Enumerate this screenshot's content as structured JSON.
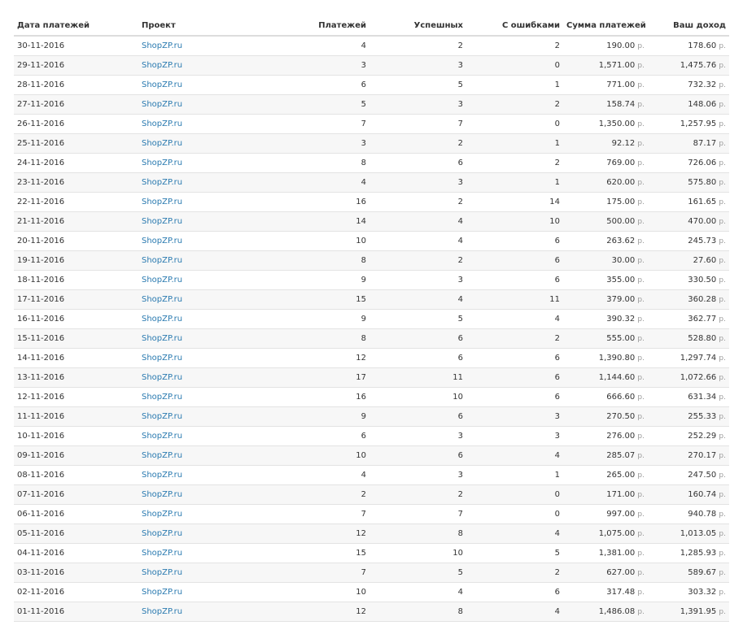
{
  "currency": "р.",
  "columns": {
    "date": "Дата платежей",
    "project": "Проект",
    "payments": "Платежей",
    "successful": "Успешных",
    "errors": "С ошибками",
    "sum": "Сумма платежей",
    "income": "Ваш доход"
  },
  "rows": [
    {
      "date": "30-11-2016",
      "project": "ShopZP.ru",
      "payments": "4",
      "successful": "2",
      "errors": "2",
      "sum": "190.00",
      "income": "178.60"
    },
    {
      "date": "29-11-2016",
      "project": "ShopZP.ru",
      "payments": "3",
      "successful": "3",
      "errors": "0",
      "sum": "1,571.00",
      "income": "1,475.76"
    },
    {
      "date": "28-11-2016",
      "project": "ShopZP.ru",
      "payments": "6",
      "successful": "5",
      "errors": "1",
      "sum": "771.00",
      "income": "732.32"
    },
    {
      "date": "27-11-2016",
      "project": "ShopZP.ru",
      "payments": "5",
      "successful": "3",
      "errors": "2",
      "sum": "158.74",
      "income": "148.06"
    },
    {
      "date": "26-11-2016",
      "project": "ShopZP.ru",
      "payments": "7",
      "successful": "7",
      "errors": "0",
      "sum": "1,350.00",
      "income": "1,257.95"
    },
    {
      "date": "25-11-2016",
      "project": "ShopZP.ru",
      "payments": "3",
      "successful": "2",
      "errors": "1",
      "sum": "92.12",
      "income": "87.17"
    },
    {
      "date": "24-11-2016",
      "project": "ShopZP.ru",
      "payments": "8",
      "successful": "6",
      "errors": "2",
      "sum": "769.00",
      "income": "726.06"
    },
    {
      "date": "23-11-2016",
      "project": "ShopZP.ru",
      "payments": "4",
      "successful": "3",
      "errors": "1",
      "sum": "620.00",
      "income": "575.80"
    },
    {
      "date": "22-11-2016",
      "project": "ShopZP.ru",
      "payments": "16",
      "successful": "2",
      "errors": "14",
      "sum": "175.00",
      "income": "161.65"
    },
    {
      "date": "21-11-2016",
      "project": "ShopZP.ru",
      "payments": "14",
      "successful": "4",
      "errors": "10",
      "sum": "500.00",
      "income": "470.00"
    },
    {
      "date": "20-11-2016",
      "project": "ShopZP.ru",
      "payments": "10",
      "successful": "4",
      "errors": "6",
      "sum": "263.62",
      "income": "245.73"
    },
    {
      "date": "19-11-2016",
      "project": "ShopZP.ru",
      "payments": "8",
      "successful": "2",
      "errors": "6",
      "sum": "30.00",
      "income": "27.60"
    },
    {
      "date": "18-11-2016",
      "project": "ShopZP.ru",
      "payments": "9",
      "successful": "3",
      "errors": "6",
      "sum": "355.00",
      "income": "330.50"
    },
    {
      "date": "17-11-2016",
      "project": "ShopZP.ru",
      "payments": "15",
      "successful": "4",
      "errors": "11",
      "sum": "379.00",
      "income": "360.28"
    },
    {
      "date": "16-11-2016",
      "project": "ShopZP.ru",
      "payments": "9",
      "successful": "5",
      "errors": "4",
      "sum": "390.32",
      "income": "362.77"
    },
    {
      "date": "15-11-2016",
      "project": "ShopZP.ru",
      "payments": "8",
      "successful": "6",
      "errors": "2",
      "sum": "555.00",
      "income": "528.80"
    },
    {
      "date": "14-11-2016",
      "project": "ShopZP.ru",
      "payments": "12",
      "successful": "6",
      "errors": "6",
      "sum": "1,390.80",
      "income": "1,297.74"
    },
    {
      "date": "13-11-2016",
      "project": "ShopZP.ru",
      "payments": "17",
      "successful": "11",
      "errors": "6",
      "sum": "1,144.60",
      "income": "1,072.66"
    },
    {
      "date": "12-11-2016",
      "project": "ShopZP.ru",
      "payments": "16",
      "successful": "10",
      "errors": "6",
      "sum": "666.60",
      "income": "631.34"
    },
    {
      "date": "11-11-2016",
      "project": "ShopZP.ru",
      "payments": "9",
      "successful": "6",
      "errors": "3",
      "sum": "270.50",
      "income": "255.33"
    },
    {
      "date": "10-11-2016",
      "project": "ShopZP.ru",
      "payments": "6",
      "successful": "3",
      "errors": "3",
      "sum": "276.00",
      "income": "252.29"
    },
    {
      "date": "09-11-2016",
      "project": "ShopZP.ru",
      "payments": "10",
      "successful": "6",
      "errors": "4",
      "sum": "285.07",
      "income": "270.17"
    },
    {
      "date": "08-11-2016",
      "project": "ShopZP.ru",
      "payments": "4",
      "successful": "3",
      "errors": "1",
      "sum": "265.00",
      "income": "247.50"
    },
    {
      "date": "07-11-2016",
      "project": "ShopZP.ru",
      "payments": "2",
      "successful": "2",
      "errors": "0",
      "sum": "171.00",
      "income": "160.74"
    },
    {
      "date": "06-11-2016",
      "project": "ShopZP.ru",
      "payments": "7",
      "successful": "7",
      "errors": "0",
      "sum": "997.00",
      "income": "940.78"
    },
    {
      "date": "05-11-2016",
      "project": "ShopZP.ru",
      "payments": "12",
      "successful": "8",
      "errors": "4",
      "sum": "1,075.00",
      "income": "1,013.05"
    },
    {
      "date": "04-11-2016",
      "project": "ShopZP.ru",
      "payments": "15",
      "successful": "10",
      "errors": "5",
      "sum": "1,381.00",
      "income": "1,285.93"
    },
    {
      "date": "03-11-2016",
      "project": "ShopZP.ru",
      "payments": "7",
      "successful": "5",
      "errors": "2",
      "sum": "627.00",
      "income": "589.67"
    },
    {
      "date": "02-11-2016",
      "project": "ShopZP.ru",
      "payments": "10",
      "successful": "4",
      "errors": "6",
      "sum": "317.48",
      "income": "303.32"
    },
    {
      "date": "01-11-2016",
      "project": "ShopZP.ru",
      "payments": "12",
      "successful": "8",
      "errors": "4",
      "sum": "1,486.08",
      "income": "1,391.95"
    }
  ]
}
